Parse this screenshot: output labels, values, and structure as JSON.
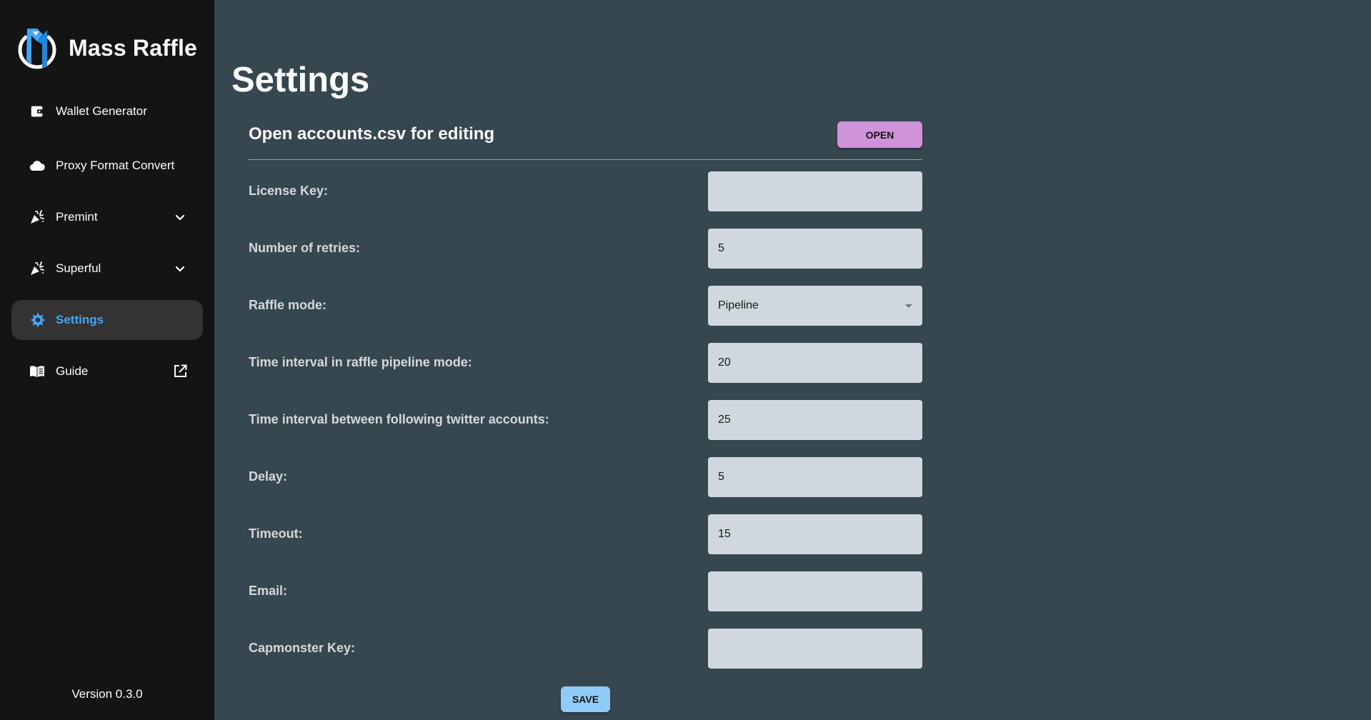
{
  "app": {
    "name": "Mass Raffle",
    "version": "Version 0.3.0"
  },
  "sidebar": {
    "items": [
      {
        "label": "Wallet Generator",
        "icon": "wallet-icon"
      },
      {
        "label": "Proxy Format Convert",
        "icon": "cloud-icon"
      },
      {
        "label": "Premint",
        "icon": "party-popper-icon",
        "expandable": true
      },
      {
        "label": "Superful",
        "icon": "party-popper-icon",
        "expandable": true
      },
      {
        "label": "Settings",
        "icon": "gear-icon",
        "active": true
      },
      {
        "label": "Guide",
        "icon": "book-icon",
        "external": true
      }
    ]
  },
  "page": {
    "title": "Settings"
  },
  "accounts": {
    "label": "Open accounts.csv for editing",
    "button": "OPEN"
  },
  "fields": {
    "license_key": {
      "label": "License Key:",
      "value": ""
    },
    "retries": {
      "label": "Number of retries:",
      "value": "5"
    },
    "raffle_mode": {
      "label": "Raffle mode:",
      "value": "Pipeline"
    },
    "pipeline_interval": {
      "label": "Time interval in raffle pipeline mode:",
      "value": "20"
    },
    "twitter_interval": {
      "label": "Time interval between following twitter accounts:",
      "value": "25"
    },
    "delay": {
      "label": "Delay:",
      "value": "5"
    },
    "timeout": {
      "label": "Timeout:",
      "value": "15"
    },
    "email": {
      "label": "Email:",
      "value": ""
    },
    "capmonster_key": {
      "label": "Capmonster Key:",
      "value": ""
    }
  },
  "save_button": "SAVE",
  "colors": {
    "sidebar_bg": "#141414",
    "main_bg": "#37474f",
    "active_accent": "#42a5f5",
    "open_button": "#ce93d8",
    "save_button": "#90caf9",
    "input_bg": "#cfd8dc"
  }
}
